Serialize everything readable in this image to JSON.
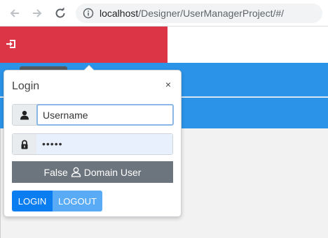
{
  "browser": {
    "url_host": "localhost",
    "url_path": "/Designer/UserManagerProject/#/",
    "icons": {
      "back": "back-arrow-icon",
      "forward": "forward-arrow-icon",
      "reload": "reload-icon",
      "info": "info-icon"
    }
  },
  "page": {
    "colors": {
      "header_red": "#dc3545",
      "band_blue": "#2b94e8",
      "primary": "#0a7ef0",
      "secondary": "#6c757d"
    },
    "header_icon": "sign-in-icon"
  },
  "login_popover": {
    "title": "Login",
    "close_label": "×",
    "username": {
      "placeholder": "",
      "value": "Username",
      "icon": "user-icon"
    },
    "password": {
      "value": "•••••",
      "icon": "lock-icon"
    },
    "domain_button": {
      "prefix": "False",
      "label": "Domain User",
      "icon": "user-outline-icon"
    },
    "login_label": "LOGIN",
    "logout_label": "LOGOUT"
  }
}
